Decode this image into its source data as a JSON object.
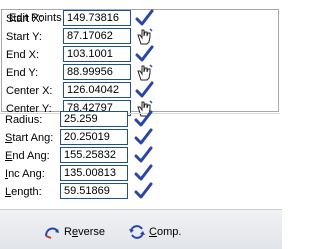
{
  "group_title": "Edit Points",
  "points": [
    {
      "label": "Start X:",
      "value": "149.73816",
      "icon": "check-icon"
    },
    {
      "label": "Start Y:",
      "value": "87.17062",
      "icon": "pick-hand-icon"
    },
    {
      "label": "End X:",
      "value": "103.1001",
      "icon": "check-icon"
    },
    {
      "label": "End Y:",
      "value": "88.99956",
      "icon": "pick-hand-icon"
    },
    {
      "label": "Center X:",
      "value": "126.04042",
      "icon": "check-icon"
    },
    {
      "label": "Center Y:",
      "value": "78.42797",
      "icon": "pick-hand-icon"
    }
  ],
  "arc": [
    {
      "label": "Radius:",
      "value": "25.259",
      "icon": "check-icon"
    },
    {
      "label_u": "S",
      "label_rest": "tart Ang:",
      "value": "20.25019",
      "icon": "check-icon"
    },
    {
      "label_u": "E",
      "label_rest": "nd Ang:",
      "value": "155.25832",
      "icon": "check-icon"
    },
    {
      "label_u": "I",
      "label_rest": "nc Ang:",
      "value": "135.00813",
      "icon": "check-icon"
    },
    {
      "label_u": "L",
      "label_rest": "ength:",
      "value": "59.51869",
      "icon": "check-icon"
    }
  ],
  "footer": {
    "reverse_pre": "R",
    "reverse_u": "e",
    "reverse_post": "verse",
    "comp_u": "C",
    "comp_post": "omp."
  },
  "colors": {
    "check": "#2a45a8",
    "field_border": "#1e4f8f"
  }
}
